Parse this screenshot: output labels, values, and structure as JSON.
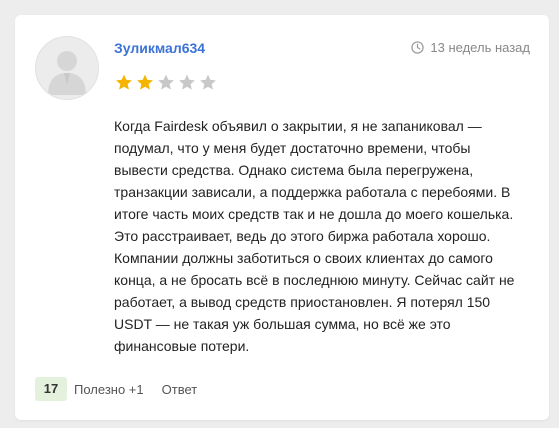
{
  "review": {
    "author": "Зуликмал634",
    "time_ago": "13 недель назад",
    "rating": 2,
    "rating_max": 5,
    "text": "Когда Fairdesk объявил о закрытии, я не запаниковал — подумал, что у меня будет достаточно времени, чтобы вывести средства. Однако система была перегружена, транзакции зависали, а поддержка работала с перебоями. В итоге часть моих средств так и не дошла до моего кошелька. Это расстраивает, ведь до этого биржа работала хорошо. Компании должны заботиться о своих клиентах до самого конца, а не бросать всё в последнюю минуту. Сейчас сайт не работает, а вывод средств приостановлен. Я потерял 150 USDT — не такая уж большая сумма, но всё же это финансовые потери."
  },
  "footer": {
    "useful_count": "17",
    "useful_label": "Полезно +1",
    "reply_label": "Ответ"
  },
  "colors": {
    "author_link": "#3b73d6",
    "star_filled": "#f4b400",
    "star_empty": "#c8c8c8",
    "count_badge_bg": "#e4f1dc"
  },
  "icons": {
    "avatar": "user-silhouette-icon",
    "time": "clock-icon",
    "rating": "star-icon"
  }
}
